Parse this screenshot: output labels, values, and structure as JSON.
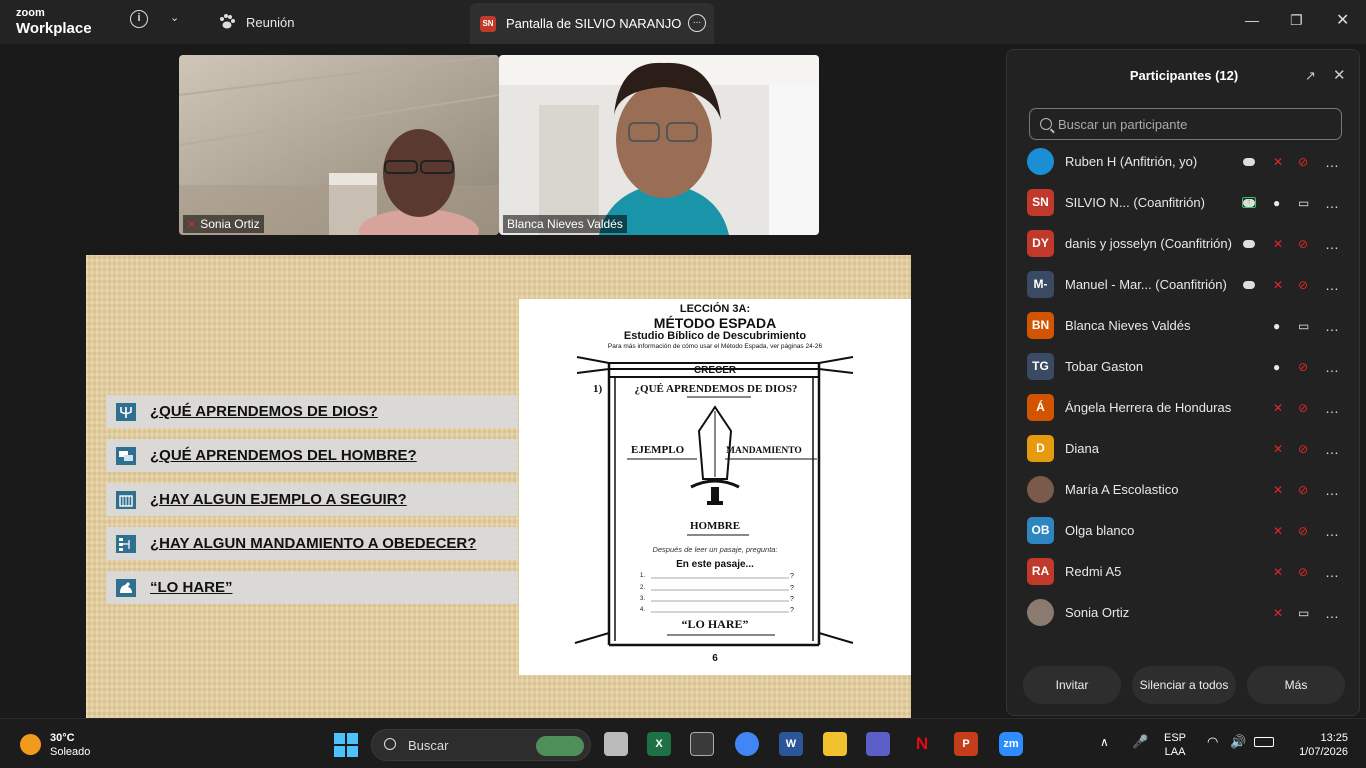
{
  "titlebar": {
    "brand_top": "zoom",
    "brand_bottom": "Workplace",
    "meeting_tab": "Reunión",
    "share_tab": "Pantalla de SILVIO NARANJO",
    "share_badge": "SN"
  },
  "videos": [
    {
      "name": "Sonia Ortiz",
      "muted": true
    },
    {
      "name": "Blanca Nieves Valdés",
      "muted": false
    }
  ],
  "slide": {
    "questions": [
      "¿QUÉ APRENDEMOS DE DIOS?",
      "¿QUÉ APRENDEMOS DEL HOMBRE?",
      "¿HAY ALGUN EJEMPLO A SEGUIR?",
      "¿HAY ALGUN MANDAMIENTO A OBEDECER?",
      "“LO HARE”"
    ],
    "page": {
      "lesson": "LECCIÓN 3A:",
      "title": "MÉTODO ESPADA",
      "subtitle": "Estudio Bíblico de Descubrimiento",
      "note": "Para más información de cómo usar el Método Espada, ver páginas 24-26",
      "banner": "CRECER",
      "q1_num": "1)",
      "q1": "¿QUÉ APRENDEMOS DE DIOS?",
      "left_label": "EJEMPLO",
      "right_label": "MANDAMIENTO",
      "bottom_label": "HOMBRE",
      "instruction": "Después de leer un pasaje, pregunta:",
      "passage": "En este pasaje...",
      "blanks": [
        "1.",
        "2.",
        "3.",
        "4."
      ],
      "qmark": "?",
      "footer": "“LO HARE”",
      "page_number": "6"
    }
  },
  "participants_panel": {
    "title": "Participantes (12)",
    "search_placeholder": "Buscar un participante",
    "participants": [
      {
        "initials": "",
        "name": "Ruben H (Anfitrión, yo)",
        "color": "#1a8fd6",
        "cloud": true,
        "share": false,
        "mic": "muted",
        "cam": "off"
      },
      {
        "initials": "SN",
        "name": "SILVIO N...  (Coanfitrión)",
        "color": "#c0392b",
        "cloud": true,
        "share": true,
        "mic": "on",
        "cam": "on"
      },
      {
        "initials": "DY",
        "name": "danis y josselyn (Coanfitrión)",
        "color": "#c0392b",
        "cloud": true,
        "share": false,
        "mic": "muted",
        "cam": "off"
      },
      {
        "initials": "M-",
        "name": "Manuel - Mar...  (Coanfitrión)",
        "color": "#3b4a63",
        "cloud": true,
        "share": false,
        "mic": "muted",
        "cam": "off"
      },
      {
        "initials": "BN",
        "name": "Blanca Nieves Valdés",
        "color": "#d35400",
        "cloud": false,
        "share": false,
        "mic": "on",
        "cam": "on"
      },
      {
        "initials": "TG",
        "name": "Tobar Gaston",
        "color": "#3b4a63",
        "cloud": false,
        "share": false,
        "mic": "on",
        "cam": "off"
      },
      {
        "initials": "Á",
        "name": "Ángela Herrera de Honduras",
        "color": "#d35400",
        "cloud": false,
        "share": false,
        "mic": "muted",
        "cam": "off"
      },
      {
        "initials": "D",
        "name": "Diana",
        "color": "#e69a10",
        "cloud": false,
        "share": false,
        "mic": "muted",
        "cam": "off"
      },
      {
        "initials": "",
        "name": "María A Escolastico",
        "color": "#7a5a4a",
        "cloud": false,
        "share": false,
        "mic": "muted",
        "cam": "off"
      },
      {
        "initials": "OB",
        "name": "Olga blanco",
        "color": "#2e86c1",
        "cloud": false,
        "share": false,
        "mic": "muted",
        "cam": "off"
      },
      {
        "initials": "RA",
        "name": "Redmi A5",
        "color": "#c0392b",
        "cloud": false,
        "share": false,
        "mic": "muted",
        "cam": "off"
      },
      {
        "initials": "",
        "name": "Sonia Ortiz",
        "color": "#8a7a70",
        "cloud": false,
        "share": false,
        "mic": "muted",
        "cam": "on"
      }
    ],
    "buttons": {
      "invite": "Invitar",
      "mute_all": "Silenciar a todos",
      "more": "Más"
    }
  },
  "taskbar": {
    "temp": "30°C",
    "condition": "Soleado",
    "search": "Buscar",
    "lang_top": "ESP",
    "lang_bottom": "LAA",
    "time": "13:25",
    "date": "1/07/2026"
  }
}
